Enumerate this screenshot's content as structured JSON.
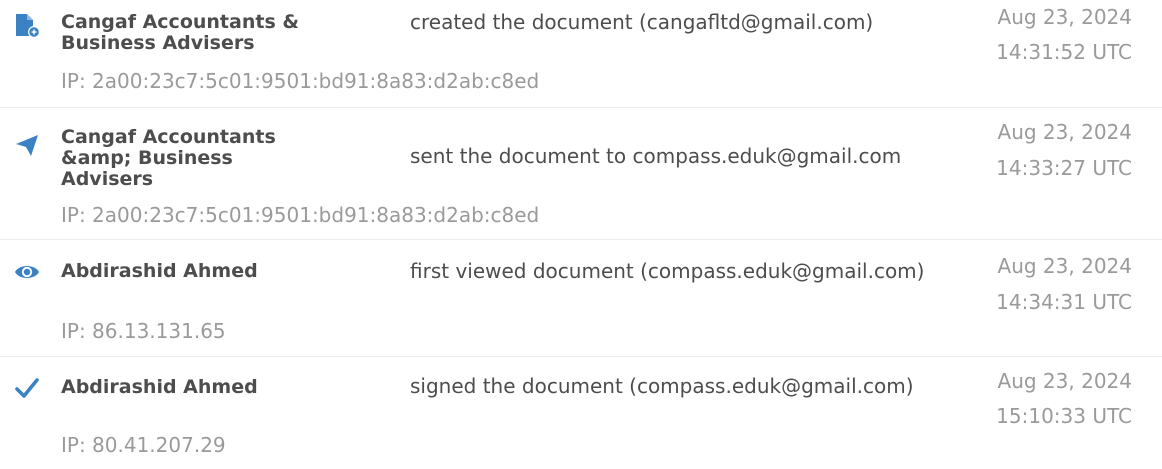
{
  "accent_color": "#3b82c4",
  "events": [
    {
      "icon": "document-created-icon",
      "actor": "Cangaf Accountants &\nBusiness Advisers",
      "action": "created the document (cangafltd@gmail.com)",
      "ip": "IP: 2a00:23c7:5c01:9501:bd91:8a83:d2ab:c8ed",
      "date": "Aug 23, 2024",
      "time": "14:31:52 UTC"
    },
    {
      "icon": "paper-plane-icon",
      "actor": "Cangaf Accountants\n&amp; Business\nAdvisers",
      "action": "sent the document to compass.eduk@gmail.com",
      "ip": "IP: 2a00:23c7:5c01:9501:bd91:8a83:d2ab:c8ed",
      "date": "Aug 23, 2024",
      "time": "14:33:27 UTC"
    },
    {
      "icon": "eye-icon",
      "actor": "Abdirashid Ahmed",
      "action": "first viewed document (compass.eduk@gmail.com)",
      "ip": "IP: 86.13.131.65",
      "date": "Aug 23, 2024",
      "time": "14:34:31 UTC"
    },
    {
      "icon": "checkmark-icon",
      "actor": "Abdirashid Ahmed",
      "action": "signed the document (compass.eduk@gmail.com)",
      "ip": "IP: 80.41.207.29",
      "date": "Aug 23, 2024",
      "time": "15:10:33 UTC"
    }
  ]
}
